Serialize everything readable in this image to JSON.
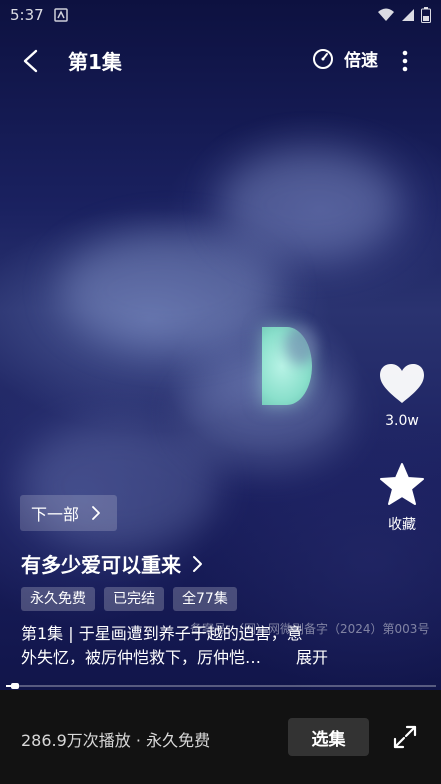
{
  "status_bar": {
    "time": "5:37"
  },
  "header": {
    "episode_title": "第1集",
    "speed_label": "倍速"
  },
  "side_actions": {
    "like_count": "3.0w",
    "collect_label": "收藏"
  },
  "next_part_label": "下一部",
  "show": {
    "title": "有多少爱可以重来",
    "tags": [
      "永久免费",
      "已完结",
      "全77集"
    ],
    "description_line1": "第1集 | 于星画遭到养子于越的迫害，意",
    "description_line2": "外失忆，被厉仲恺救下，厉仲恺…",
    "expand_label": "展开"
  },
  "watermark": "备案号：（网）网微剧备字（2024）第003号",
  "progress": {
    "played_fraction": 0.02
  },
  "bottom_bar": {
    "play_info": "286.9万次播放 · 永久免费",
    "select_button": "选集"
  },
  "icons": [
    "back-arrow-icon",
    "speed-dial-icon",
    "more-vertical-icon",
    "heart-icon",
    "star-icon",
    "chevron-right-icon",
    "fullscreen-icon",
    "wifi-icon",
    "signal-icon",
    "battery-icon",
    "notification-icon"
  ]
}
